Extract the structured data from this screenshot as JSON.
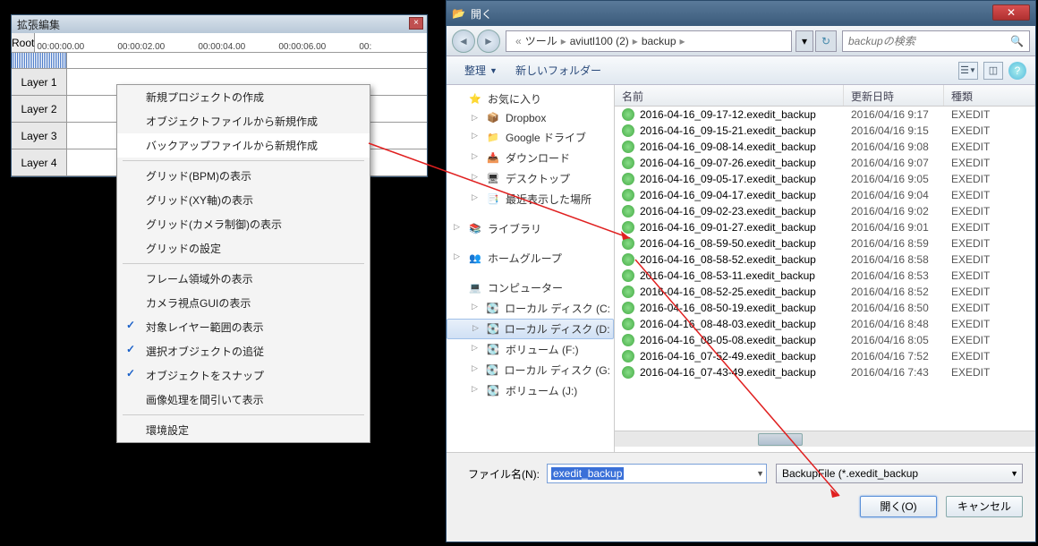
{
  "timeline": {
    "title": "拡張編集",
    "root": "Root",
    "times": [
      "00:00:00.00",
      "00:00:02.00",
      "00:00:04.00",
      "00:00:06.00",
      "00:"
    ],
    "layers": [
      "Layer 1",
      "Layer 2",
      "Layer 3",
      "Layer 4"
    ]
  },
  "context_menu": {
    "items": [
      {
        "label": "新規プロジェクトの作成",
        "type": "item"
      },
      {
        "label": "オブジェクトファイルから新規作成",
        "type": "item"
      },
      {
        "label": "バックアップファイルから新規作成",
        "type": "item",
        "highlight": true
      },
      {
        "type": "sep"
      },
      {
        "label": "グリッド(BPM)の表示",
        "type": "item"
      },
      {
        "label": "グリッド(XY軸)の表示",
        "type": "item"
      },
      {
        "label": "グリッド(カメラ制御)の表示",
        "type": "item"
      },
      {
        "label": "グリッドの設定",
        "type": "item"
      },
      {
        "type": "sep"
      },
      {
        "label": "フレーム領域外の表示",
        "type": "item"
      },
      {
        "label": "カメラ視点GUIの表示",
        "type": "item"
      },
      {
        "label": "対象レイヤー範囲の表示",
        "type": "item",
        "checked": true
      },
      {
        "label": "選択オブジェクトの追従",
        "type": "item",
        "checked": true
      },
      {
        "label": "オブジェクトをスナップ",
        "type": "item",
        "checked": true
      },
      {
        "label": "画像処理を間引いて表示",
        "type": "item"
      },
      {
        "type": "sep"
      },
      {
        "label": "環境設定",
        "type": "item"
      }
    ]
  },
  "file_dialog": {
    "title": "開く",
    "breadcrumb": [
      "ツール",
      "aviutl100 (2)",
      "backup"
    ],
    "search_placeholder": "backupの検索",
    "toolbar": {
      "organize": "整理",
      "new_folder": "新しいフォルダー"
    },
    "tree": {
      "favorites": {
        "label": "お気に入り",
        "icon": "⭐",
        "items": [
          {
            "label": "Dropbox",
            "icon": "📦"
          },
          {
            "label": "Google ドライブ",
            "icon": "📁"
          },
          {
            "label": "ダウンロード",
            "icon": "📥"
          },
          {
            "label": "デスクトップ",
            "icon": "🖥"
          },
          {
            "label": "最近表示した場所",
            "icon": "📑"
          }
        ]
      },
      "library": {
        "label": "ライブラリ",
        "icon": "📚"
      },
      "homegroup": {
        "label": "ホームグループ",
        "icon": "👥"
      },
      "computer": {
        "label": "コンピューター",
        "icon": "💻",
        "items": [
          {
            "label": "ローカル ディスク (C:",
            "icon": "💽"
          },
          {
            "label": "ローカル ディスク (D:",
            "icon": "💽",
            "selected": true
          },
          {
            "label": "ボリューム (F:)",
            "icon": "💽"
          },
          {
            "label": "ローカル ディスク (G:",
            "icon": "💽"
          },
          {
            "label": "ボリューム (J:)",
            "icon": "💽"
          }
        ]
      }
    },
    "columns": {
      "name": "名前",
      "date": "更新日時",
      "type": "種類"
    },
    "files": [
      {
        "name": "2016-04-16_09-17-12.exedit_backup",
        "date": "2016/04/16 9:17",
        "type": "EXEDIT"
      },
      {
        "name": "2016-04-16_09-15-21.exedit_backup",
        "date": "2016/04/16 9:15",
        "type": "EXEDIT"
      },
      {
        "name": "2016-04-16_09-08-14.exedit_backup",
        "date": "2016/04/16 9:08",
        "type": "EXEDIT"
      },
      {
        "name": "2016-04-16_09-07-26.exedit_backup",
        "date": "2016/04/16 9:07",
        "type": "EXEDIT"
      },
      {
        "name": "2016-04-16_09-05-17.exedit_backup",
        "date": "2016/04/16 9:05",
        "type": "EXEDIT"
      },
      {
        "name": "2016-04-16_09-04-17.exedit_backup",
        "date": "2016/04/16 9:04",
        "type": "EXEDIT"
      },
      {
        "name": "2016-04-16_09-02-23.exedit_backup",
        "date": "2016/04/16 9:02",
        "type": "EXEDIT"
      },
      {
        "name": "2016-04-16_09-01-27.exedit_backup",
        "date": "2016/04/16 9:01",
        "type": "EXEDIT"
      },
      {
        "name": "2016-04-16_08-59-50.exedit_backup",
        "date": "2016/04/16 8:59",
        "type": "EXEDIT"
      },
      {
        "name": "2016-04-16_08-58-52.exedit_backup",
        "date": "2016/04/16 8:58",
        "type": "EXEDIT"
      },
      {
        "name": "2016-04-16_08-53-11.exedit_backup",
        "date": "2016/04/16 8:53",
        "type": "EXEDIT"
      },
      {
        "name": "2016-04-16_08-52-25.exedit_backup",
        "date": "2016/04/16 8:52",
        "type": "EXEDIT"
      },
      {
        "name": "2016-04-16_08-50-19.exedit_backup",
        "date": "2016/04/16 8:50",
        "type": "EXEDIT"
      },
      {
        "name": "2016-04-16_08-48-03.exedit_backup",
        "date": "2016/04/16 8:48",
        "type": "EXEDIT"
      },
      {
        "name": "2016-04-16_08-05-08.exedit_backup",
        "date": "2016/04/16 8:05",
        "type": "EXEDIT"
      },
      {
        "name": "2016-04-16_07-52-49.exedit_backup",
        "date": "2016/04/16 7:52",
        "type": "EXEDIT"
      },
      {
        "name": "2016-04-16_07-43-49.exedit_backup",
        "date": "2016/04/16 7:43",
        "type": "EXEDIT"
      }
    ],
    "filename_label": "ファイル名(N):",
    "filename_value": "exedit_backup",
    "filter": "BackupFile (*.exedit_backup",
    "open_btn": "開く(O)",
    "cancel_btn": "キャンセル"
  }
}
